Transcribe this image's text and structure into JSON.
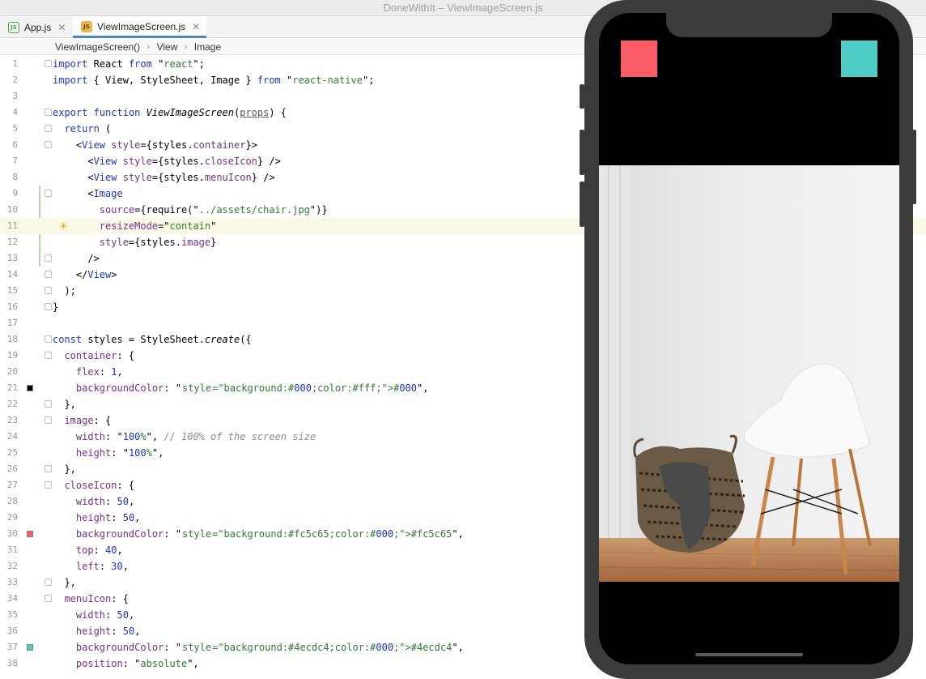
{
  "window": {
    "title": "DoneWithIt – ViewImageScreen.js"
  },
  "tabs": [
    {
      "label": "App.js",
      "active": false
    },
    {
      "label": "ViewImageScreen.js",
      "active": true
    }
  ],
  "breadcrumb": [
    "ViewImageScreen()",
    "View",
    "Image"
  ],
  "code_lines": [
    "import React from \"react\";",
    "import { View, StyleSheet, Image } from \"react-native\";",
    "",
    "export function ViewImageScreen(props) {",
    "  return (",
    "    <View style={styles.container}>",
    "      <View style={styles.closeIcon} />",
    "      <View style={styles.menuIcon} />",
    "      <Image",
    "        source={require(\"../assets/chair.jpg\")}",
    "        resizeMode=\"contain\"",
    "        style={styles.image}",
    "      />",
    "    </View>",
    "  );",
    "}",
    "",
    "const styles = StyleSheet.create({",
    "  container: {",
    "    flex: 1,",
    "    backgroundColor: \"#000\",",
    "  },",
    "  image: {",
    "    width: \"100%\", // 100% of the screen size",
    "    height: \"100%\",",
    "  },",
    "  closeIcon: {",
    "    width: 50,",
    "    height: 50,",
    "    backgroundColor: \"#fc5c65\",",
    "    top: 40,",
    "    left: 30,",
    "  },",
    "  menuIcon: {",
    "    width: 50,",
    "    height: 50,",
    "    backgroundColor: \"#4ecdc4\",",
    "    position: \"absolute\","
  ],
  "line_numbers": [
    "1",
    "2",
    "3",
    "4",
    "5",
    "6",
    "7",
    "8",
    "9",
    "10",
    "11",
    "12",
    "13",
    "14",
    "15",
    "16",
    "17",
    "18",
    "19",
    "20",
    "21",
    "22",
    "23",
    "24",
    "25",
    "26",
    "27",
    "28",
    "29",
    "30",
    "31",
    "32",
    "33",
    "34",
    "35",
    "36",
    "37",
    "38"
  ],
  "highlighted_line": "11",
  "colors": {
    "close_icon": "#fc5c65",
    "menu_icon": "#4ecdc4",
    "container_bg": "#000"
  },
  "icons": {
    "lightbulb": "lightbulb-icon",
    "js_file": "js-file-icon",
    "close_tab": "close-icon"
  }
}
